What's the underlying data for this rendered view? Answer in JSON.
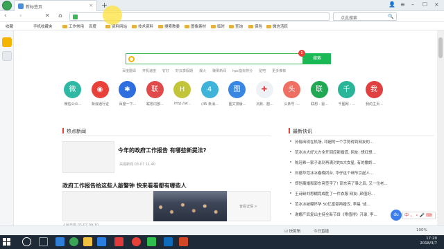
{
  "tab": {
    "title": "新标签页",
    "close": "×",
    "new": "+"
  },
  "window": {
    "user": "👤",
    "menu": "≡",
    "minimize": "–",
    "maximize": "☐",
    "close": "×"
  },
  "nav": {
    "back": "‹",
    "forward": "›",
    "stop": "✕",
    "home": "⌂",
    "down": "⬇",
    "search_text": "点此搜索",
    "search_icon": "🔍",
    "arrow": "›"
  },
  "bookmarks": [
    {
      "label": "收藏",
      "folder": false
    },
    {
      "label": "手机收藏夹",
      "folder": false
    },
    {
      "label": "工作常用",
      "folder": true
    },
    {
      "label": "百度",
      "folder": false
    },
    {
      "label": "资料网站",
      "folder": true
    },
    {
      "label": "技术资料",
      "folder": true
    },
    {
      "label": "搜索教委",
      "folder": true
    },
    {
      "label": "图像素材",
      "folder": true
    },
    {
      "label": "临时",
      "folder": true
    },
    {
      "label": "查询",
      "folder": true
    },
    {
      "label": "保险",
      "folder": true
    },
    {
      "label": "微信活跃",
      "folder": true
    }
  ],
  "search": {
    "button": "搜索",
    "badge": "1"
  },
  "hotwords": [
    "百度翻译",
    "开机速度",
    "钉钉",
    "好云季假期",
    "爆火",
    "赚果新闻",
    "hpc指标排分",
    "贴吧",
    "更多推荐"
  ],
  "apps": [
    {
      "icon": "微",
      "label": "微信公众...",
      "color": "#2fb9a4"
    },
    {
      "icon": "◉",
      "label": "新浪通行证",
      "color": "#e8413a"
    },
    {
      "icon": "✱",
      "label": "百度一下...",
      "color": "#2f6ede"
    },
    {
      "icon": "联",
      "label": "联想内部...",
      "color": "#e04a4a"
    },
    {
      "icon": "H",
      "label": "http://w...",
      "color": "#c2c43a"
    },
    {
      "icon": "4",
      "label": "(45 条消...",
      "color": "#3fb3d8"
    },
    {
      "icon": "图",
      "label": "图文排版...",
      "color": "#3a86e3"
    },
    {
      "icon": "✚",
      "label": "沉默、腊...",
      "color": "#eef1f5"
    },
    {
      "icon": "头",
      "label": "头条号 -...",
      "color": "#ef6f63"
    },
    {
      "icon": "联",
      "label": "联想 - 鼠...",
      "color": "#21a853"
    },
    {
      "icon": "千",
      "label": "千图网 - ...",
      "color": "#2ab598"
    },
    {
      "icon": "我",
      "label": "我的主页...",
      "color": "#e04040"
    }
  ],
  "hot_news": {
    "header": "热点新闻",
    "items": [
      {
        "title": "今年的政府工作报告 有哪些新提法?",
        "meta": "央视新闻   03-07 11:40"
      },
      {
        "title": "政府工作报告给这些人敲警钟 快来看看都有哪些人",
        "more": "查看详情 >",
        "meta": "人民日报   03-07 09:10"
      }
    ]
  },
  "latest": {
    "header": "最新快讯",
    "items": [
      "孙俪出现在机场, 邓超的一个手势得到网友的...",
      "范冰冰大好大方全开回应新婚道, 网友: 想红想...",
      "陈冠希一家子说到再满对的5大女星, 有的撒娇...",
      "刘德华范冰冰春晚同台, 华仔这个细节引起人...",
      "郑恺离婚和郭东亮签字了! 郭东亮了事之后, 又一位老...",
      "王诗龄刘思糊竟成胜了一件衣服 网友: 颜值好...",
      "范冰冰被曝怀孕 50亿富豪再婚汉, 李晨 '成...",
      "谢娜产后复出主持全新节目《零值得》开录, 李..."
    ]
  },
  "float": {
    "baidu": "du",
    "ime": "中 ， ∘ 🎤 ⌨"
  },
  "status": {
    "left": "☑ 快剪辑",
    "hot": "今日直播",
    "zoom": "100%"
  },
  "taskbar": {
    "time": "17:20",
    "date": "2018/3/7"
  },
  "colors": {
    "accent": "#19b955",
    "badge": "#e8413a",
    "taskbar": "#1e2a38"
  }
}
